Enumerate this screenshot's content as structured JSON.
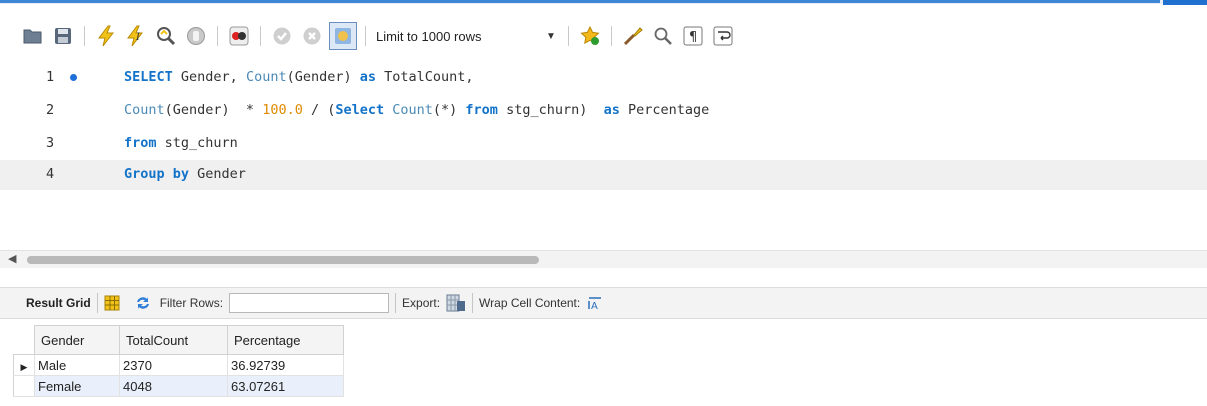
{
  "toolbar": {
    "limit_label": "Limit to 1000 rows",
    "icons": [
      "open-folder-icon",
      "save-icon",
      "execute-icon",
      "execute-current-icon",
      "explain-icon",
      "stop-icon",
      "toggle-error-icon",
      "commit-icon",
      "rollback-icon",
      "autocommit-icon",
      "beautify-icon",
      "format-icon",
      "find-icon",
      "invisible-chars-icon",
      "wrap-icon"
    ]
  },
  "editor": {
    "lines": [
      {
        "num": "1",
        "has_marker": true
      },
      {
        "num": "2",
        "has_marker": false
      },
      {
        "num": "3",
        "has_marker": false
      },
      {
        "num": "4",
        "has_marker": false
      }
    ],
    "tokens": {
      "l1_select": "SELECT",
      "l1_gender": " Gender, ",
      "l1_count": "Count",
      "l1_arg": "(Gender) ",
      "l1_as": "as",
      "l1_alias": " TotalCount,",
      "l2_count": "Count",
      "l2_arg": "(Gender)  * ",
      "l2_num": "100.0",
      "l2_div": " / (",
      "l2_select": "Select",
      "l2_space": " ",
      "l2_count2": "Count",
      "l2_star": "(*) ",
      "l2_from": "from",
      "l2_table": " stg_churn)  ",
      "l2_as": "as",
      "l2_alias": " Percentage",
      "l3_from": "from",
      "l3_table": " stg_churn",
      "l4_group": "Group by",
      "l4_col": " Gender"
    }
  },
  "results": {
    "result_grid_label": "Result Grid",
    "filter_label": "Filter Rows:",
    "filter_value": "",
    "export_label": "Export:",
    "wrap_label": "Wrap Cell Content:",
    "columns": [
      "Gender",
      "TotalCount",
      "Percentage"
    ],
    "rows": [
      [
        "Male",
        "2370",
        "36.92739"
      ],
      [
        "Female",
        "4048",
        "63.07261"
      ]
    ]
  }
}
